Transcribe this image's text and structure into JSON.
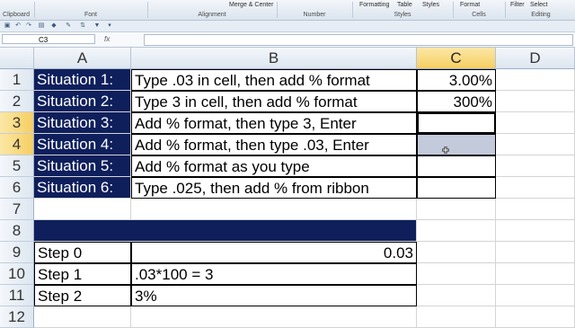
{
  "ribbon": {
    "groups": [
      "Clipboard",
      "Font",
      "Alignment",
      "Number",
      "Styles",
      "Cells",
      "Editing"
    ],
    "top_buttons": [
      "Merge & Center",
      "Formatting",
      "Table",
      "Styles",
      "Format",
      "Filter",
      "Select"
    ]
  },
  "name_box": "C3",
  "formula_bar": {
    "fx": "fx",
    "value": ""
  },
  "columns": [
    "A",
    "B",
    "C",
    "D"
  ],
  "selected_columns": [
    "C"
  ],
  "rows": [
    "1",
    "2",
    "3",
    "4",
    "5",
    "6",
    "7",
    "8",
    "9",
    "10",
    "11",
    "12"
  ],
  "selected_rows": [
    "3",
    "4"
  ],
  "cells": {
    "A1": "Situation 1:",
    "B1": "Type .03 in cell, then add % format",
    "C1": "3.00%",
    "A2": "Situation 2:",
    "B2": "Type 3 in cell, then add % format",
    "C2": "300%",
    "A3": "Situation 3:",
    "B3": "Add % format, then type 3, Enter",
    "A4": "Situation 4:",
    "B4": "Add % format, then type .03, Enter",
    "A5": "Situation 5:",
    "B5": "Add % format as you type",
    "A6": "Situation 6:",
    "B6": "Type .025, then add % from ribbon",
    "A9": "Step 0",
    "B9": "0.03",
    "A10": "Step 1",
    "B10": ".03*100 = 3",
    "A11": "Step 2",
    "B11": "3%"
  },
  "colors": {
    "navy": "#0e1f5c",
    "selection": "#c2cadb",
    "header_selected": "#f6cf62"
  }
}
